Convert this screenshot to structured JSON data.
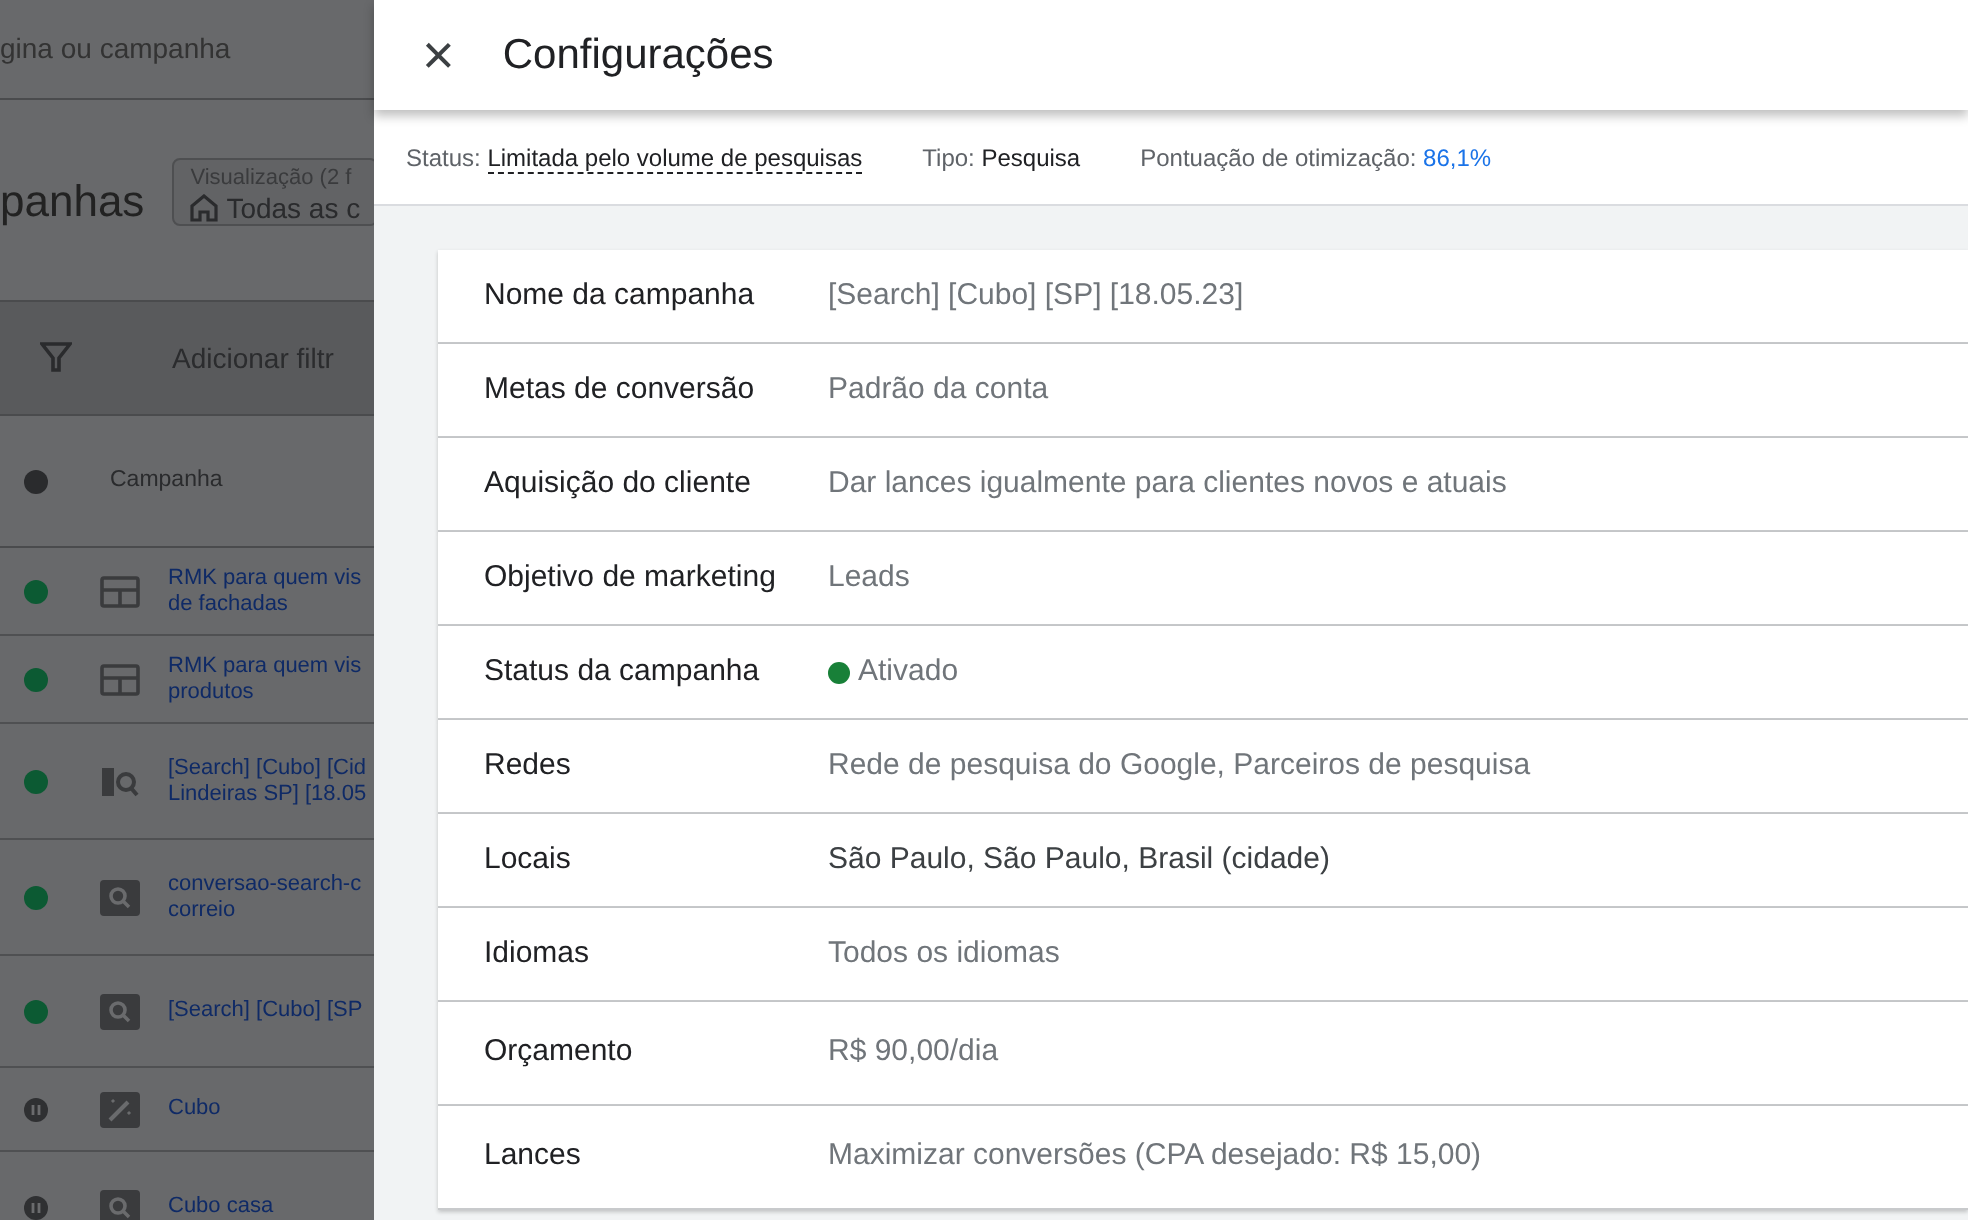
{
  "background_page": {
    "search": {
      "placeholder": "gina ou campanha"
    },
    "title": "panhas",
    "view_selector": {
      "label": "Visualização (2 f",
      "value": "Todas as c"
    },
    "filter": {
      "label": "Adicionar filtr"
    },
    "table": {
      "columns": [
        "Campanha"
      ],
      "rows": [
        {
          "paused": false,
          "kind": "display",
          "name": "RMK para quem vis\nde fachadas"
        },
        {
          "paused": false,
          "kind": "display",
          "name": "RMK para quem vis\nprodutos"
        },
        {
          "paused": false,
          "kind": "searchpartner",
          "name": "[Search] [Cubo] [Cid\nLindeiras SP] [18.05"
        },
        {
          "paused": false,
          "kind": "search",
          "name": "conversao-search-c\ncorreio"
        },
        {
          "paused": false,
          "kind": "search",
          "name": "[Search] [Cubo] [SP"
        },
        {
          "paused": true,
          "kind": "smart",
          "name": "Cubo"
        },
        {
          "paused": true,
          "kind": "search",
          "name": "Cubo casa"
        }
      ]
    }
  },
  "panel": {
    "title": "Configurações",
    "close": "×",
    "summary": [
      {
        "label": "Status:",
        "value": "Limitada pelo volume de pesquisas",
        "kind": "tooltip"
      },
      {
        "label": "Tipo:",
        "value": "Pesquisa",
        "kind": "plain"
      },
      {
        "label": "Pontuação de otimização:",
        "value": "86,1%",
        "kind": "score"
      }
    ],
    "settings": [
      {
        "label": "Nome da campanha",
        "value": "[Search] [Cubo] [SP] [18.05.23]",
        "kind": "text",
        "emphasized": false
      },
      {
        "label": "Metas de conversão",
        "value": "Padrão da conta",
        "kind": "text",
        "emphasized": false
      },
      {
        "label": "Aquisição do cliente",
        "value": "Dar lances igualmente para clientes novos e atuais",
        "kind": "text",
        "emphasized": false
      },
      {
        "label": "Objetivo de marketing",
        "value": "Leads",
        "kind": "text",
        "emphasized": false
      },
      {
        "label": "Status da campanha",
        "value": "Ativado",
        "kind": "status",
        "color": "#188038",
        "emphasized": false
      },
      {
        "label": "Redes",
        "value": "Rede de pesquisa do Google, Parceiros de pesquisa",
        "kind": "text",
        "emphasized": false
      },
      {
        "label": "Locais",
        "value": "São Paulo, São Paulo, Brasil (cidade)",
        "kind": "text",
        "emphasized": true
      },
      {
        "label": "Idiomas",
        "value": "Todos os idiomas",
        "kind": "text",
        "emphasized": false
      },
      {
        "label": "Orçamento",
        "value": "R$ 90,00/dia",
        "kind": "text",
        "emphasized": false
      },
      {
        "label": "Lances",
        "value": "Maximizar conversões (CPA desejado: R$ 15,00)",
        "kind": "text",
        "emphasized": false
      }
    ]
  }
}
